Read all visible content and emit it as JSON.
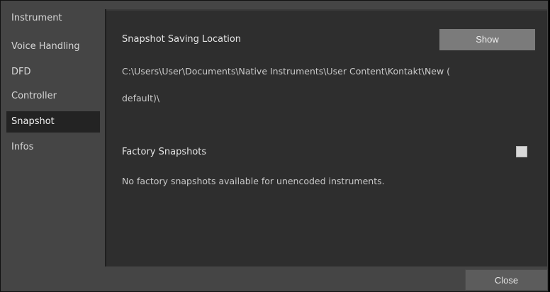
{
  "sidebar": {
    "items": [
      {
        "label": "Instrument"
      },
      {
        "label": "Voice Handling"
      },
      {
        "label": "DFD"
      },
      {
        "label": "Controller"
      },
      {
        "label": "Snapshot",
        "selected": true
      },
      {
        "label": "Infos"
      }
    ]
  },
  "snapshot": {
    "saving_location_label": "Snapshot Saving Location",
    "show_button": "Show",
    "path_line1": "C:\\Users\\User\\Documents\\Native Instruments\\User Content\\Kontakt\\New (",
    "path_line2": "default)\\",
    "factory_label": "Factory Snapshots",
    "factory_checked": false,
    "factory_note": "No factory snapshots available for unencoded instruments."
  },
  "footer": {
    "close_button": "Close"
  },
  "colors": {
    "background": "#454545",
    "panel": "#2e2e2e",
    "selected_item": "#232323",
    "show_button": "#7b7b7b",
    "close_button": "#5c5c5c"
  }
}
